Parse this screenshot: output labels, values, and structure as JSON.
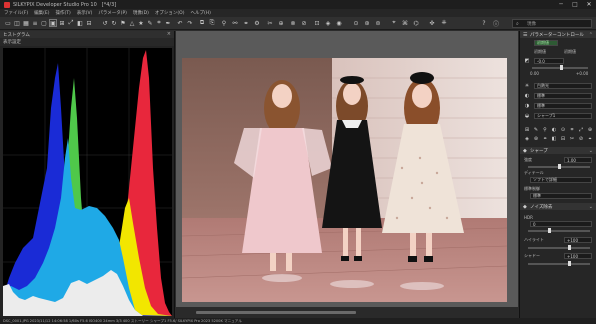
{
  "window": {
    "title": "SILKYPIX Developer Studio Pro 10　[*4/3]"
  },
  "menu": [
    "ファイル(F)",
    "編集(E)",
    "操作(T)",
    "表示(V)",
    "パラメータ(P)",
    "現像(D)",
    "オプション(O)",
    "ヘルプ(H)"
  ],
  "toolbar": {
    "search_label": "現像"
  },
  "left_panel": {
    "header": "ヒストグラム",
    "subheader": "表示設定"
  },
  "right_panel": {
    "header": "パラメーターコントロール",
    "preset": "初期値",
    "tab_left": "初期値",
    "tab_right": "初期値",
    "field_a": "-0.0",
    "val_left": "0.00",
    "val_right": "+0.00",
    "wb_label": "白熱光",
    "tone_label": "標準",
    "color_label": "標準",
    "style_label": "シャープ1",
    "sharp_section": "シャープ",
    "sharp_row_label": "強度",
    "sharp_value": "1.00",
    "detail_label": "ディテール",
    "detail_value": "ソフトで詳細",
    "noise_label": "標準制御",
    "noise2_label": "標準",
    "section_b": "ノイズ除去",
    "hdr_label": "HDR",
    "hdr_value": "0",
    "hl_label": "ハイライト",
    "hl_value": "+100",
    "sh_label": "シャドー",
    "sh_value": "+100"
  },
  "statusbar": {
    "text": "DSC_0001.JPG  2023/11/12 14:06:58  1/60s  F5.6  ISO400  24mm  3/3  400  ストーリー  シャープ1  F5.6/  SILKYPIX  Pro  2023  5200K  マニュアル"
  },
  "colors": {
    "red": "#e8273c",
    "yellow": "#f2e600",
    "green": "#4fc84a",
    "cyan": "#1fa9e6",
    "blue": "#1a2bd6",
    "white": "#ececec"
  }
}
